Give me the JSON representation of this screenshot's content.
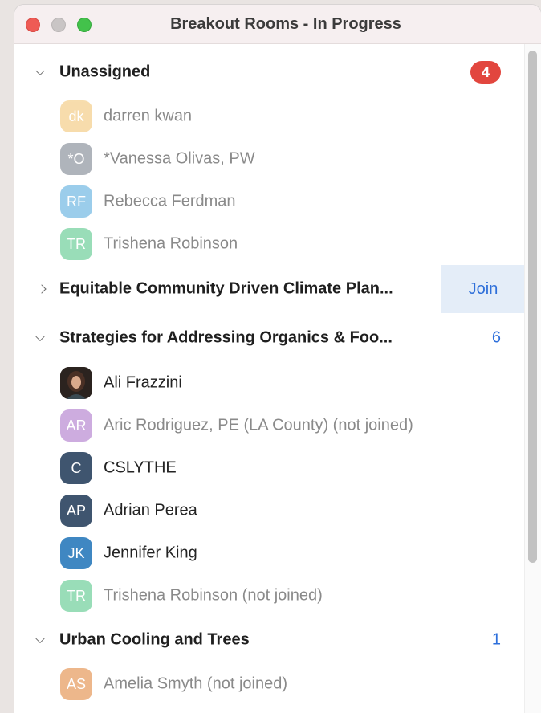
{
  "window": {
    "title": "Breakout Rooms - In Progress"
  },
  "colors": {
    "accent": "#2e6fd9",
    "badge": "#e2463e",
    "join_bg": "#e4edf8"
  },
  "unassigned": {
    "label": "Unassigned",
    "badge": "4",
    "participants": [
      {
        "initials": "dk",
        "name": "darren kwan",
        "color": "#f1c169"
      },
      {
        "initials": "*O",
        "name": "*Vanessa Olivas, PW",
        "color": "#6f7784"
      },
      {
        "initials": "RF",
        "name": "Rebecca Ferdman",
        "color": "#4aa6db"
      },
      {
        "initials": "TR",
        "name": "Trishena Robinson",
        "color": "#47c27f"
      }
    ]
  },
  "rooms": [
    {
      "name": "Equitable Community Driven Climate Plan...",
      "join_label": "Join"
    },
    {
      "name": "Strategies for Addressing Organics & Foo...",
      "count": "6",
      "participants": [
        {
          "initials": "",
          "name": "Ali Frazzini",
          "icon": "photo-avatar",
          "joined": true
        },
        {
          "initials": "AR",
          "name": "Aric Rodriguez, PE (LA County) (not joined)",
          "color": "#a56ac6",
          "joined": false
        },
        {
          "initials": "C",
          "name": "CSLYTHE",
          "color": "#3f556f",
          "joined": true
        },
        {
          "initials": "AP",
          "name": "Adrian Perea",
          "color": "#3f556f",
          "joined": true
        },
        {
          "initials": "JK",
          "name": "Jennifer King",
          "color": "#3f87c2",
          "joined": true
        },
        {
          "initials": "TR",
          "name": "Trishena Robinson (not joined)",
          "color": "#47c27f",
          "joined": false
        }
      ]
    },
    {
      "name": "Urban Cooling and Trees",
      "count": "1",
      "participants": [
        {
          "initials": "AS",
          "name": "Amelia Smyth (not joined)",
          "color": "#e07d2e",
          "joined": false
        }
      ]
    }
  ]
}
